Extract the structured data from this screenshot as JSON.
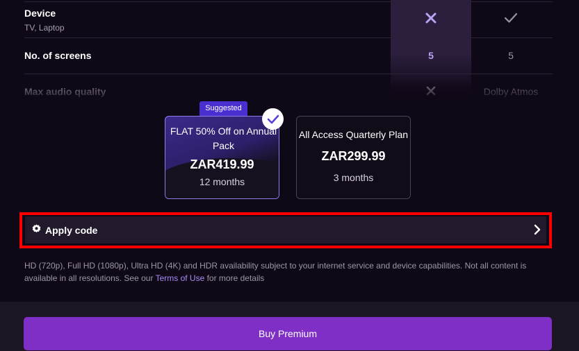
{
  "features": [
    {
      "name": "Device",
      "sub": "TV, Laptop",
      "plan_a": "x-icon",
      "plan_b": "check-icon"
    },
    {
      "name": "No. of screens",
      "sub": "",
      "plan_a": "5",
      "plan_b": "5"
    },
    {
      "name": "Max audio quality",
      "sub": "",
      "plan_a": "x-icon",
      "plan_b": "Dolby Atmos"
    }
  ],
  "plans": [
    {
      "badge": "Suggested",
      "name": "FLAT 50% Off on Annual Pack",
      "price": "ZAR419.99",
      "duration": "12 months",
      "selected": true
    },
    {
      "name": "All Access Quarterly Plan",
      "price": "ZAR299.99",
      "duration": "3 months",
      "selected": false
    }
  ],
  "apply_code": {
    "label": "Apply code",
    "icon": "gear-badge-icon"
  },
  "disclaimer": {
    "text_before": "HD (720p), Full HD (1080p), Ultra HD (4K) and HDR availability subject to your internet service and device capabilities. Not all content is available in all resolutions. See our ",
    "link": "Terms of Use",
    "text_after": " for more details"
  },
  "buy_button": {
    "label": "Buy Premium"
  },
  "colors": {
    "accent": "#7f2fc6",
    "plan_accent": "#4a2fd0",
    "highlight": "#ff0000"
  }
}
